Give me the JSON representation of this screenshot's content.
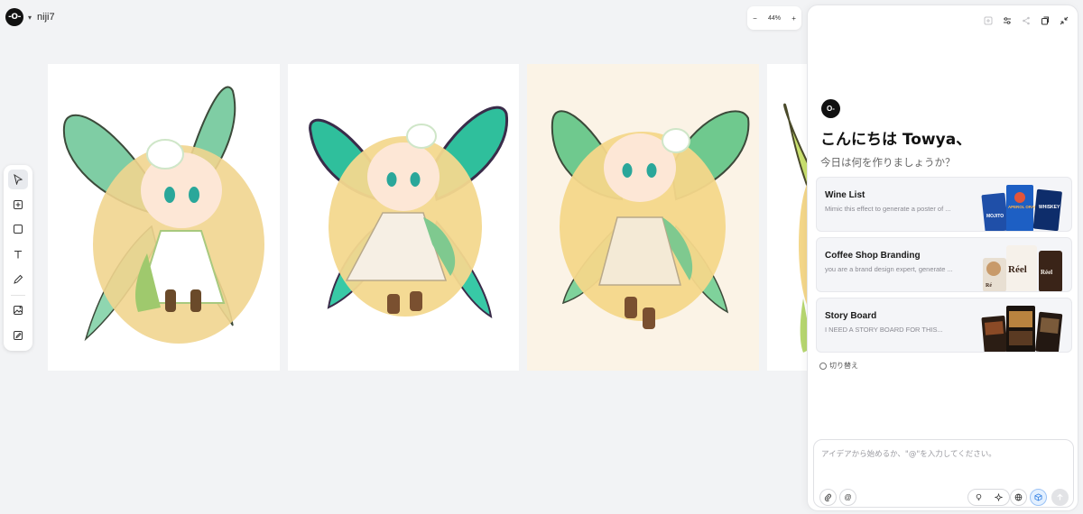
{
  "project": {
    "logo_text": "-O-",
    "name": "niji7"
  },
  "zoom": {
    "minus": "−",
    "level": "44%",
    "plus": "+"
  },
  "toolbar": {
    "tools": [
      "select-icon",
      "add-frame-icon",
      "rectangle-icon",
      "text-icon",
      "pen-icon",
      "image-gen-icon",
      "image-edit-icon"
    ]
  },
  "panel": {
    "logo_text": "O-",
    "greeting": "こんにちは Towya、",
    "subtitle": "今日は何を作りましょうか？",
    "cards": [
      {
        "title": "Wine List",
        "desc": "Mimic this effect to generate a poster of ..."
      },
      {
        "title": "Coffee Shop Branding",
        "desc": "you are a brand design expert, generate ..."
      },
      {
        "title": "Story Board",
        "desc": "I NEED A STORY BOARD FOR THIS..."
      }
    ],
    "card_thumb_text": {
      "wine_1": "MOJITO",
      "wine_2": "APEROL ORANGE LIGHT",
      "wine_3": "WHISKEY",
      "coffee_1": "Réel",
      "coffee_2": "Réel",
      "coffee_3": "Ré"
    },
    "switch_label": "切り替え",
    "input_placeholder": "アイデアから始めるか、\"@\"を入力してください。",
    "mention_symbol": "@"
  },
  "colors": {
    "canvas_bg": "#f2f3f5",
    "panel_bg": "#ffffff",
    "card_bg": "#f4f5f8",
    "accent_blue": "#2f7de1",
    "wing_green": "#6fc79e",
    "hair_blond": "#f1d58f"
  }
}
